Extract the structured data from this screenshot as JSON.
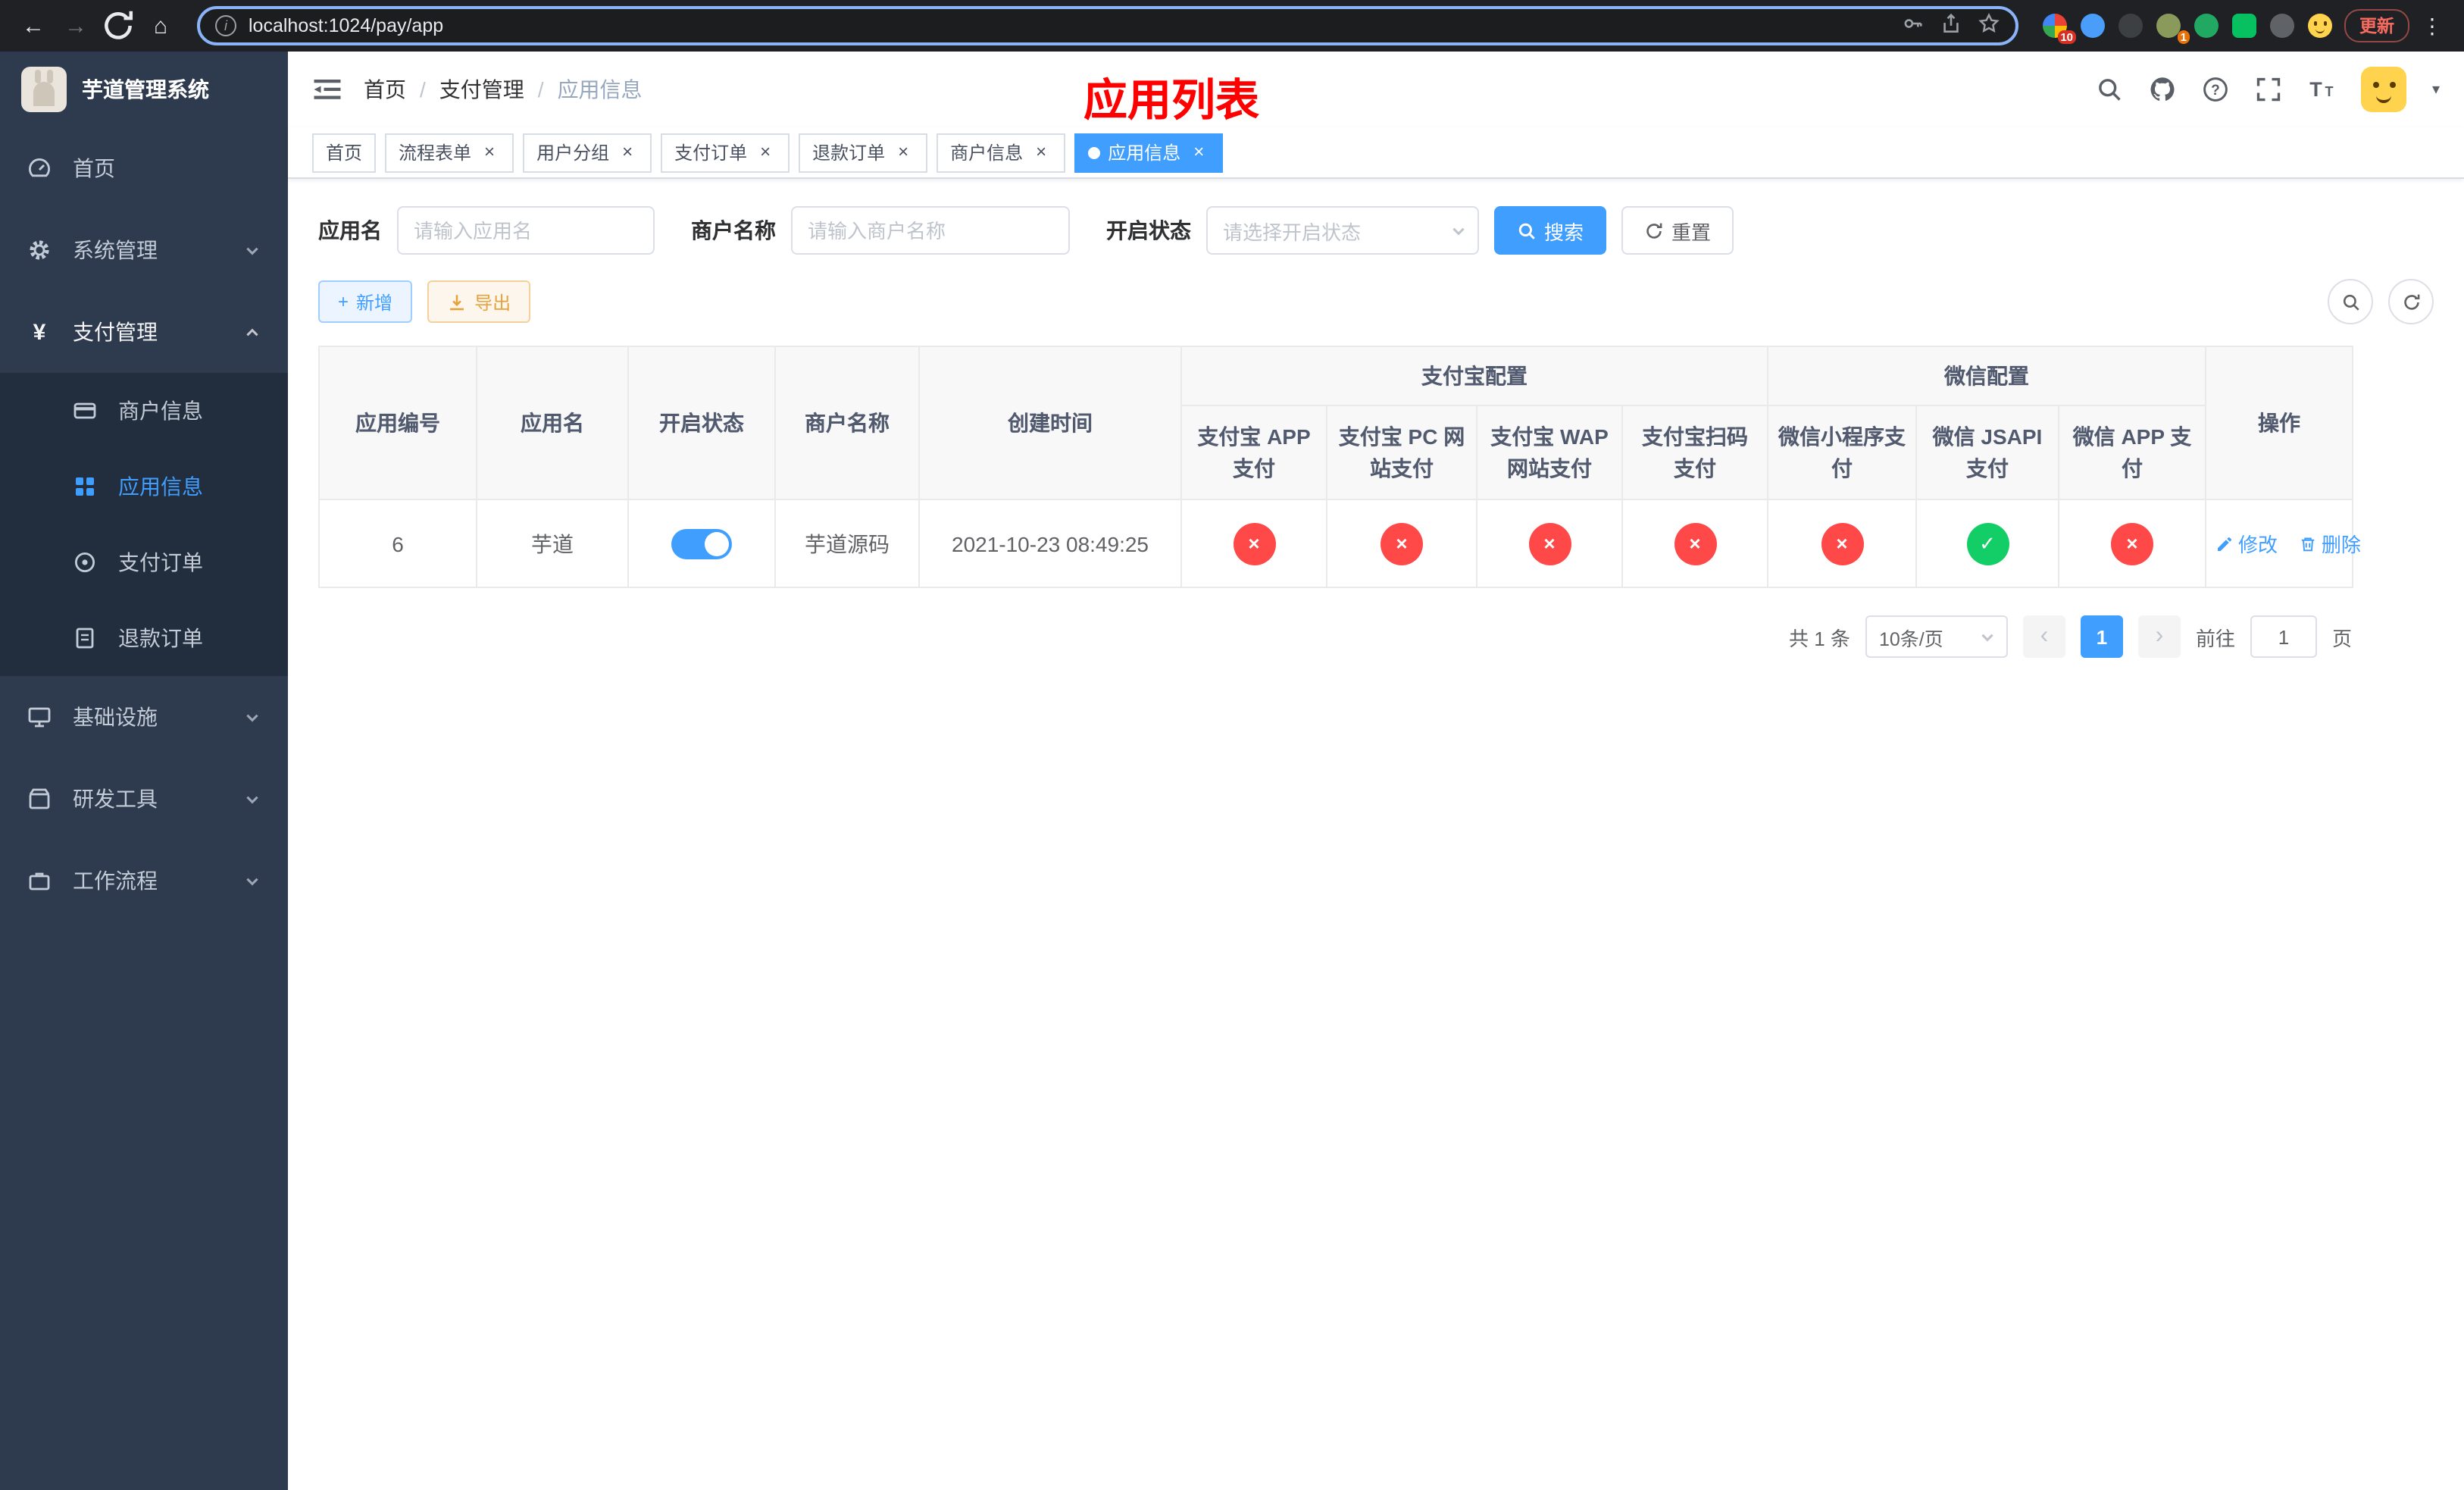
{
  "colors": {
    "accent": "#409eff",
    "success": "#13ce66",
    "danger": "#ff4949",
    "title_red": "#ff0000",
    "warning": "#e6a23c"
  },
  "icons": {
    "close": "×",
    "check": "✓",
    "cross": "×",
    "caret": "▾",
    "menu_dots": "⋮",
    "back": "←",
    "forward": "→",
    "home": "⌂",
    "prev": "‹",
    "next": "›",
    "plus": "+",
    "info": "i",
    "yen": "¥"
  },
  "browser": {
    "url": "localhost:1024/pay/app",
    "update_label": "更新",
    "ext_badge_1": "10",
    "ext_badge_2": "1"
  },
  "sidebar": {
    "title": "芋道管理系统",
    "home": "首页",
    "system": "系统管理",
    "pay": "支付管理",
    "merchant": "商户信息",
    "app": "应用信息",
    "pay_order": "支付订单",
    "refund_order": "退款订单",
    "infra": "基础设施",
    "devtools": "研发工具",
    "workflow": "工作流程"
  },
  "header": {
    "breadcrumb": [
      "首页",
      "支付管理",
      "应用信息"
    ],
    "separator": "/",
    "title": "应用列表"
  },
  "tabs": {
    "items": [
      "首页",
      "流程表单",
      "用户分组",
      "支付订单",
      "退款订单",
      "商户信息",
      "应用信息"
    ]
  },
  "filters": {
    "app_name_label": "应用名",
    "app_name_placeholder": "请输入应用名",
    "merchant_label": "商户名称",
    "merchant_placeholder": "请输入商户名称",
    "status_label": "开启状态",
    "status_placeholder": "请选择开启状态",
    "search_label": "搜索",
    "reset_label": "重置"
  },
  "toolbar": {
    "add_label": "新增",
    "export_label": "导出"
  },
  "table": {
    "headers": {
      "app_id": "应用编号",
      "app_name": "应用名",
      "status": "开启状态",
      "merchant": "商户名称",
      "created": "创建时间",
      "alipay_group": "支付宝配置",
      "wechat_group": "微信配置",
      "alipay_app": "支付宝 APP 支付",
      "alipay_pc": "支付宝 PC 网站支付",
      "alipay_wap": "支付宝 WAP 网站支付",
      "alipay_qr": "支付宝扫码支付",
      "wx_mini": "微信小程序支付",
      "wx_jsapi": "微信 JSAPI 支付",
      "wx_app": "微信 APP 支付",
      "actions": "操作"
    },
    "row": {
      "id": "6",
      "name": "芋道",
      "status_on": true,
      "merchant": "芋道源码",
      "created": "2021-10-23 08:49:25",
      "configs": [
        "no",
        "no",
        "no",
        "no",
        "no",
        "yes",
        "no"
      ],
      "edit_label": "修改",
      "delete_label": "删除"
    }
  },
  "pagination": {
    "total": "共 1 条",
    "size": "10条/页",
    "page": "1",
    "goto_label": "前往",
    "goto_value": "1",
    "unit": "页"
  }
}
